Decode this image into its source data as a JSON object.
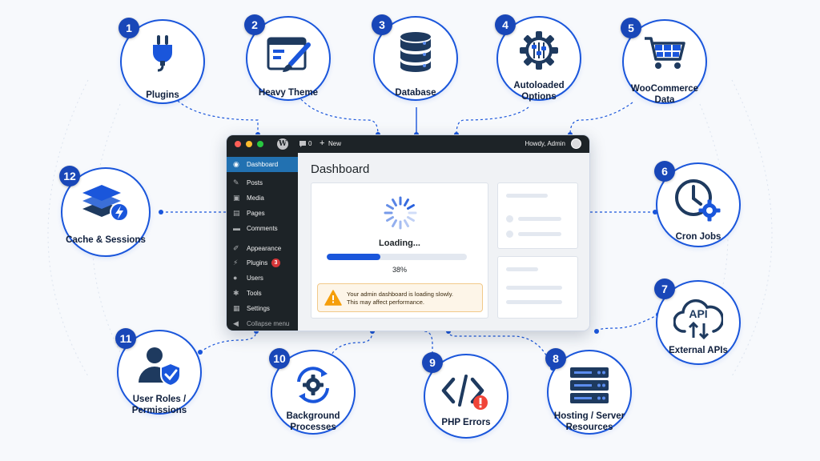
{
  "colors": {
    "accent": "#1a56db",
    "badge": "#1947b8",
    "wp_dark": "#1d2327",
    "wp_blue": "#2271b1",
    "warning": "#f59e0b",
    "error": "#f04438"
  },
  "factors": [
    {
      "number": "1",
      "label": "Plugins",
      "icon": "plug-icon"
    },
    {
      "number": "2",
      "label": "Heavy Theme",
      "icon": "theme-brush-icon"
    },
    {
      "number": "3",
      "label": "Database",
      "icon": "database-icon"
    },
    {
      "number": "4",
      "label": "Autoloaded Options",
      "icon": "gear-sliders-icon"
    },
    {
      "number": "5",
      "label": "WooCommerce Data",
      "icon": "shopping-cart-icon"
    },
    {
      "number": "6",
      "label": "Cron Jobs",
      "icon": "clock-gear-icon"
    },
    {
      "number": "7",
      "label": "External APIs",
      "icon": "api-cloud-icon"
    },
    {
      "number": "8",
      "label": "Hosting / Server Resources",
      "icon": "server-icon"
    },
    {
      "number": "9",
      "label": "PHP Errors",
      "icon": "code-error-icon"
    },
    {
      "number": "10",
      "label": "Background Processes",
      "icon": "sync-gear-icon"
    },
    {
      "number": "11",
      "label": "User Roles / Permissions",
      "icon": "user-shield-icon"
    },
    {
      "number": "12",
      "label": "Cache & Sessions",
      "icon": "layers-bolt-icon"
    }
  ],
  "admin": {
    "comments_count": "0",
    "new_label": "New",
    "howdy": "Howdy, Admin",
    "menu": [
      {
        "label": "Dashboard",
        "icon": "dashboard-icon"
      },
      {
        "label": "Posts",
        "icon": "pin-icon"
      },
      {
        "label": "Media",
        "icon": "media-icon"
      },
      {
        "label": "Pages",
        "icon": "pages-icon"
      },
      {
        "label": "Comments",
        "icon": "comment-icon"
      },
      {
        "label": "Appearance",
        "icon": "brush-icon"
      },
      {
        "label": "Plugins",
        "icon": "plugin-icon",
        "badge": "3"
      },
      {
        "label": "Users",
        "icon": "user-icon"
      },
      {
        "label": "Tools",
        "icon": "wrench-icon"
      },
      {
        "label": "Settings",
        "icon": "settings-icon"
      },
      {
        "label": "Collapse menu",
        "icon": "collapse-icon"
      }
    ],
    "page_title": "Dashboard",
    "loading_text": "Loading...",
    "progress": 38,
    "progress_text": "38%",
    "warning_line1": "Your admin dashboard is loading slowly.",
    "warning_line2": "This may affect performance."
  }
}
